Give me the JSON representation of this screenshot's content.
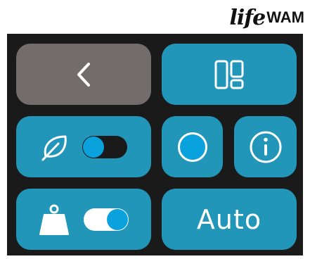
{
  "brand": {
    "script": "life",
    "word": "WAM"
  },
  "controls": {
    "back": {
      "icon": "chevron-left-icon"
    },
    "layout": {
      "icon": "layout-grid-icon"
    },
    "eco": {
      "icon": "leaf-icon",
      "toggle_state": "off"
    },
    "color": {
      "icon": "color-dot-icon"
    },
    "info": {
      "icon": "info-icon"
    },
    "weight": {
      "icon": "weight-icon",
      "toggle_state": "on"
    },
    "auto": {
      "label": "Auto"
    }
  },
  "colors": {
    "button": "#2196b9",
    "back_button": "#726c6d",
    "panel": "#1a1a1a",
    "accent": "#0aa2dc"
  }
}
